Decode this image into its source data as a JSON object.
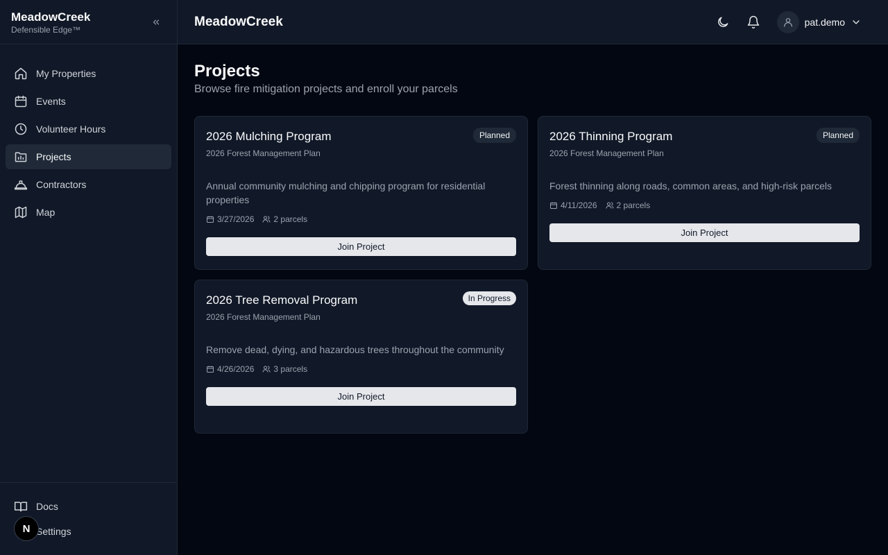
{
  "sidebar": {
    "brand": "MeadowCreek",
    "subtitle": "Defensible Edge™",
    "items": [
      {
        "label": "My Properties",
        "icon": "home-icon"
      },
      {
        "label": "Events",
        "icon": "calendar-icon"
      },
      {
        "label": "Volunteer Hours",
        "icon": "clock-icon"
      },
      {
        "label": "Projects",
        "icon": "folder-chart-icon",
        "active": true
      },
      {
        "label": "Contractors",
        "icon": "hard-hat-icon"
      },
      {
        "label": "Map",
        "icon": "map-icon"
      }
    ],
    "bottom": [
      {
        "label": "Docs",
        "icon": "book-icon"
      },
      {
        "label": "Settings",
        "icon": "gear-icon"
      }
    ],
    "dev_badge": "N"
  },
  "header": {
    "title": "MeadowCreek",
    "user": "pat.demo"
  },
  "page": {
    "title": "Projects",
    "subtitle": "Browse fire mitigation projects and enroll your parcels"
  },
  "projects": [
    {
      "title": "2026 Mulching Program",
      "plan": "2026 Forest Management Plan",
      "status": "Planned",
      "description": "Annual community mulching and chipping program for residential properties",
      "date": "3/27/2026",
      "parcels": "2 parcels",
      "action": "Join Project"
    },
    {
      "title": "2026 Thinning Program",
      "plan": "2026 Forest Management Plan",
      "status": "Planned",
      "description": "Forest thinning along roads, common areas, and high-risk parcels",
      "date": "4/11/2026",
      "parcels": "2 parcels",
      "action": "Join Project"
    },
    {
      "title": "2026 Tree Removal Program",
      "plan": "2026 Forest Management Plan",
      "status": "In Progress",
      "description": "Remove dead, dying, and hazardous trees throughout the community",
      "date": "4/26/2026",
      "parcels": "3 parcels",
      "action": "Join Project"
    }
  ],
  "colors": {
    "background": "#030712",
    "panel": "#111827",
    "border": "#1f2937",
    "muted_text": "#9ca3af",
    "button": "#e5e7eb"
  }
}
